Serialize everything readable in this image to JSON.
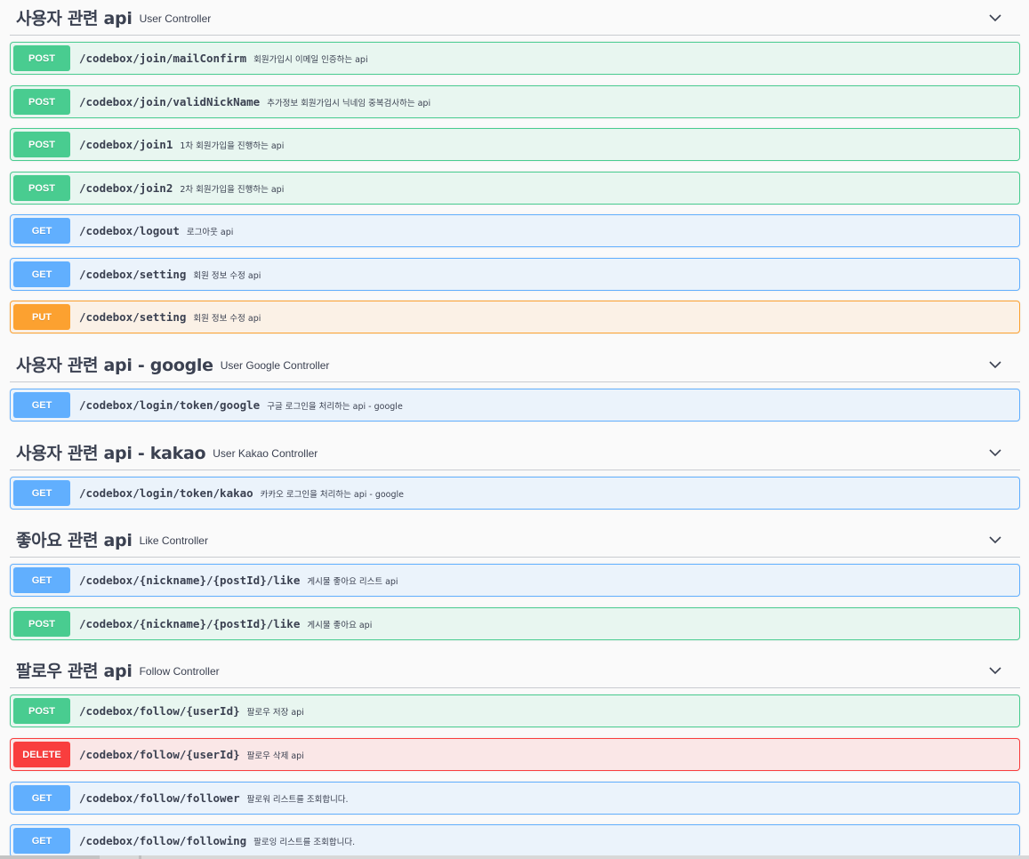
{
  "sections": [
    {
      "title": "사용자 관련 api",
      "description": "User Controller",
      "operations": [
        {
          "method": "POST",
          "path": "/codebox/join/mailConfirm",
          "summary": "회원가입시 이메일 인증하는 api"
        },
        {
          "method": "POST",
          "path": "/codebox/join/validNickName",
          "summary": "추가정보 회원가입시 닉네임 중복검사하는 api"
        },
        {
          "method": "POST",
          "path": "/codebox/join1",
          "summary": "1차 회원가입을 진행하는 api"
        },
        {
          "method": "POST",
          "path": "/codebox/join2",
          "summary": "2차 회원가입을 진행하는 api"
        },
        {
          "method": "GET",
          "path": "/codebox/logout",
          "summary": "로그아웃 api"
        },
        {
          "method": "GET",
          "path": "/codebox/setting",
          "summary": "회원 정보 수정 api"
        },
        {
          "method": "PUT",
          "path": "/codebox/setting",
          "summary": "회원 정보 수정 api"
        }
      ]
    },
    {
      "title": "사용자 관련 api - google",
      "description": "User Google Controller",
      "operations": [
        {
          "method": "GET",
          "path": "/codebox/login/token/google",
          "summary": "구글 로그인을 처리하는 api - google"
        }
      ]
    },
    {
      "title": "사용자 관련 api - kakao",
      "description": "User Kakao Controller",
      "operations": [
        {
          "method": "GET",
          "path": "/codebox/login/token/kakao",
          "summary": "카카오 로그인을 처리하는 api - google"
        }
      ]
    },
    {
      "title": "좋아요 관련 api",
      "description": "Like Controller",
      "operations": [
        {
          "method": "GET",
          "path": "/codebox/{nickname}/{postId}/like",
          "summary": "게시물 좋아요 리스트 api"
        },
        {
          "method": "POST",
          "path": "/codebox/{nickname}/{postId}/like",
          "summary": "게시물 좋아요 api"
        }
      ]
    },
    {
      "title": "팔로우 관련 api",
      "description": "Follow Controller",
      "operations": [
        {
          "method": "POST",
          "path": "/codebox/follow/{userId}",
          "summary": "팔로우 저장 api"
        },
        {
          "method": "DELETE",
          "path": "/codebox/follow/{userId}",
          "summary": "팔로우 삭제 api"
        },
        {
          "method": "GET",
          "path": "/codebox/follow/follower",
          "summary": "팔로워 리스트를 조회합니다."
        },
        {
          "method": "GET",
          "path": "/codebox/follow/following",
          "summary": "팔로잉 리스트를 조회합니다."
        }
      ]
    }
  ],
  "icons": {
    "collapse": "chevron-down-icon"
  },
  "colors": {
    "post": "#49cc90",
    "get": "#61affe",
    "put": "#fca130",
    "delete": "#f93e3e",
    "text": "#3b4151"
  }
}
